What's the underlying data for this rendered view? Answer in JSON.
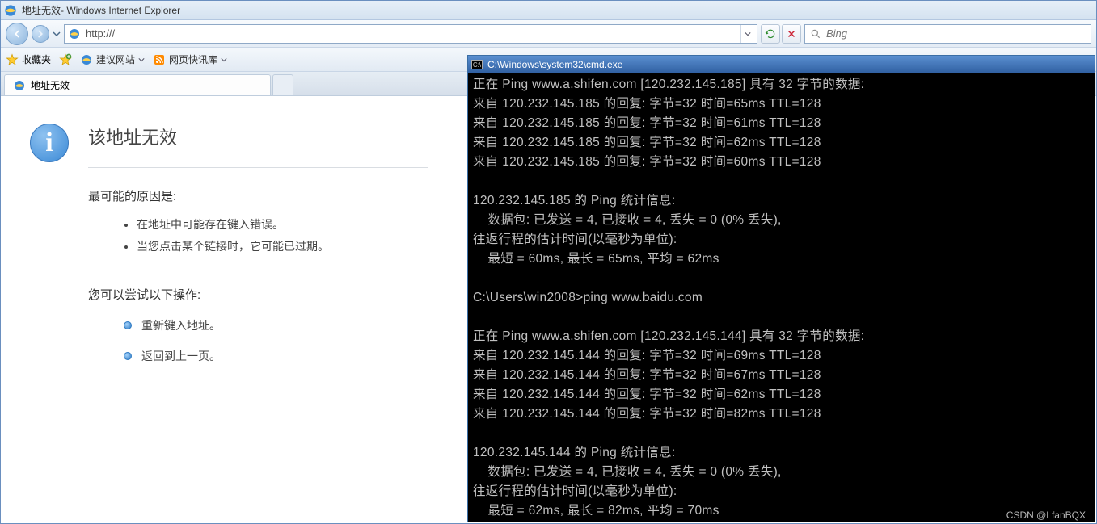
{
  "ie": {
    "window_title_page": "地址无效",
    "window_title_app": " - Windows Internet Explorer",
    "url": "http:///",
    "search_placeholder": "Bing",
    "fav_label": "收藏夹",
    "fav_links": [
      {
        "label": "建议网站",
        "has_dd": true
      },
      {
        "label": "网页快讯库",
        "has_dd": true
      }
    ],
    "tab_label": "地址无效",
    "error": {
      "heading": "该地址无效",
      "causes_title": "最可能的原因是:",
      "causes": [
        "在地址中可能存在键入错误。",
        "当您点击某个链接时，它可能已过期。"
      ],
      "try_title": "您可以尝试以下操作:",
      "actions": [
        "重新键入地址。",
        "返回到上一页。"
      ]
    }
  },
  "cmd": {
    "title": "C:\\Windows\\system32\\cmd.exe",
    "lines": [
      "正在 Ping www.a.shifen.com [120.232.145.185] 具有 32 字节的数据:",
      "来自 120.232.145.185 的回复: 字节=32 时间=65ms TTL=128",
      "来自 120.232.145.185 的回复: 字节=32 时间=61ms TTL=128",
      "来自 120.232.145.185 的回复: 字节=32 时间=62ms TTL=128",
      "来自 120.232.145.185 的回复: 字节=32 时间=60ms TTL=128",
      "",
      "120.232.145.185 的 Ping 统计信息:",
      "    数据包: 已发送 = 4, 已接收 = 4, 丢失 = 0 (0% 丢失),",
      "往返行程的估计时间(以毫秒为单位):",
      "    最短 = 60ms, 最长 = 65ms, 平均 = 62ms",
      "",
      "C:\\Users\\win2008>ping www.baidu.com",
      "",
      "正在 Ping www.a.shifen.com [120.232.145.144] 具有 32 字节的数据:",
      "来自 120.232.145.144 的回复: 字节=32 时间=69ms TTL=128",
      "来自 120.232.145.144 的回复: 字节=32 时间=67ms TTL=128",
      "来自 120.232.145.144 的回复: 字节=32 时间=62ms TTL=128",
      "来自 120.232.145.144 的回复: 字节=32 时间=82ms TTL=128",
      "",
      "120.232.145.144 的 Ping 统计信息:",
      "    数据包: 已发送 = 4, 已接收 = 4, 丢失 = 0 (0% 丢失),",
      "往返行程的估计时间(以毫秒为单位):",
      "    最短 = 62ms, 最长 = 82ms, 平均 = 70ms"
    ]
  },
  "watermark": "CSDN @LfanBQX"
}
